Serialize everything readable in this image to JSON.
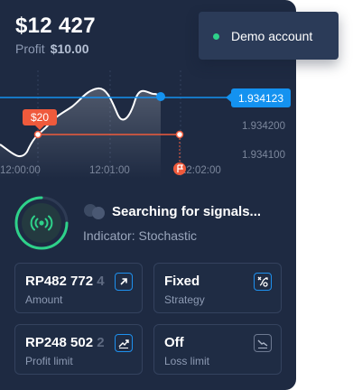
{
  "header": {
    "balance": "$12 427",
    "profit_label": "Profit",
    "profit_value": "$10.00"
  },
  "chart": {
    "current_price": "1.934123",
    "price_ticks": [
      "1.934200",
      "1.934100"
    ],
    "time_ticks": [
      "12:00:00",
      "12:01:00",
      "12:02:00"
    ],
    "bet_amount": "$20"
  },
  "signal": {
    "title": "Searching for signals...",
    "indicator": "Indicator: Stochastic"
  },
  "tiles": {
    "amount": {
      "value": "RP482 772",
      "value_fade": " 4",
      "label": "Amount"
    },
    "strategy": {
      "value": "Fixed",
      "label": "Strategy"
    },
    "profit_limit": {
      "value": "RP248 502",
      "value_fade": " 2",
      "label": "Profit limit"
    },
    "loss_limit": {
      "value": "Off",
      "label": "Loss limit"
    }
  },
  "popup": {
    "text": "Demo account"
  },
  "colors": {
    "accent": "#1492f0",
    "bet": "#ef5a3c",
    "signal": "#2ed18a"
  }
}
